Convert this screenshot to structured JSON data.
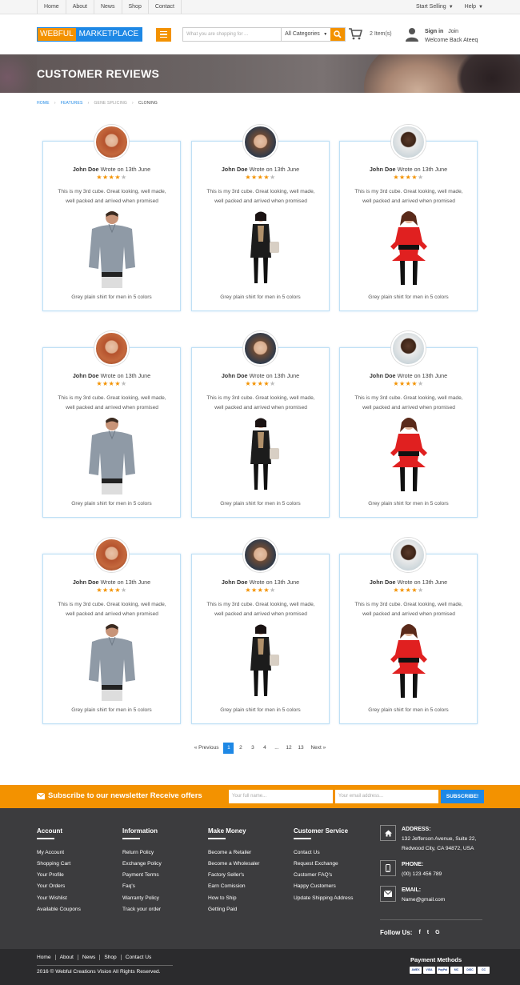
{
  "topbar": {
    "nav": [
      "Home",
      "About",
      "News",
      "Shop",
      "Contact"
    ],
    "start_selling": "Start Selling",
    "help": "Help"
  },
  "header": {
    "logo_part1": "WEBFUL",
    "logo_part2": "MARKETPLACE",
    "search_placeholder": "What you are shopping for ...",
    "category": "All Categories",
    "cart_count": "2 Item(s)",
    "sign_in": "Sign in",
    "join": "Join",
    "welcome": "Welcome Back Ateeq"
  },
  "banner": {
    "title": "CUSTOMER REVIEWS"
  },
  "breadcrumb": [
    "HOME",
    "FEATURES",
    "GENE SPLICING",
    "CLONING"
  ],
  "reviews": [
    {
      "name": "John Doe",
      "wrote": "Wrote on 13th June",
      "rating": 4,
      "text": "This is my 3rd cube. Great looking, well made, well packed and arrived when promised",
      "caption": "Grey plain shirt for men in 5 colors",
      "avatar": "woman-redhead",
      "product": "grey-shirt"
    },
    {
      "name": "John Doe",
      "wrote": "Wrote on 13th June",
      "rating": 4,
      "text": "This is my 3rd cube. Great looking, well made, well packed and arrived when promised",
      "caption": "Grey plain shirt for men in 5 colors",
      "avatar": "man-glasses",
      "product": "black-coat"
    },
    {
      "name": "John Doe",
      "wrote": "Wrote on 13th June",
      "rating": 4,
      "text": "This is my 3rd cube. Great looking, well made, well packed and arrived when promised",
      "caption": "Grey plain shirt for men in 5 colors",
      "avatar": "man-smiling",
      "product": "red-top"
    },
    {
      "name": "John Doe",
      "wrote": "Wrote on 13th June",
      "rating": 4,
      "text": "This is my 3rd cube. Great looking, well made, well packed and arrived when promised",
      "caption": "Grey plain shirt for men in 5 colors",
      "avatar": "woman-redhead",
      "product": "grey-shirt"
    },
    {
      "name": "John Doe",
      "wrote": "Wrote on 13th June",
      "rating": 4,
      "text": "This is my 3rd cube. Great looking, well made, well packed and arrived when promised",
      "caption": "Grey plain shirt for men in 5 colors",
      "avatar": "man-glasses",
      "product": "black-coat"
    },
    {
      "name": "John Doe",
      "wrote": "Wrote on 13th June",
      "rating": 4,
      "text": "This is my 3rd cube. Great looking, well made, well packed and arrived when promised",
      "caption": "Grey plain shirt for men in 5 colors",
      "avatar": "man-smiling",
      "product": "red-top"
    },
    {
      "name": "John Doe",
      "wrote": "Wrote on 13th June",
      "rating": 4,
      "text": "This is my 3rd cube. Great looking, well made, well packed and arrived when promised",
      "caption": "Grey plain shirt for men in 5 colors",
      "avatar": "woman-redhead",
      "product": "grey-shirt"
    },
    {
      "name": "John Doe",
      "wrote": "Wrote on 13th June",
      "rating": 4,
      "text": "This is my 3rd cube. Great looking, well made, well packed and arrived when promised",
      "caption": "Grey plain shirt for men in 5 colors",
      "avatar": "man-glasses",
      "product": "black-coat"
    },
    {
      "name": "John Doe",
      "wrote": "Wrote on 13th June",
      "rating": 4,
      "text": "This is my 3rd cube. Great looking, well made, well packed and arrived when promised",
      "caption": "Grey plain shirt for men in 5 colors",
      "avatar": "man-smiling",
      "product": "red-top"
    }
  ],
  "pagination": {
    "previous": "« Previous",
    "pages": [
      "1",
      "2",
      "3",
      "4",
      "...",
      "12",
      "13"
    ],
    "current": "1",
    "next": "Next »"
  },
  "newsletter": {
    "title": "Subscribe to our newsletter Receive offers",
    "name_placeholder": "Your full name...",
    "email_placeholder": "Your email address...",
    "button": "SUBSCRIBE!"
  },
  "footer": {
    "account": {
      "title": "Account",
      "links": [
        "My Account",
        "Shopping Cart",
        "Your Profile",
        "Your Orders",
        "Your Wishlist",
        "Available Coupons"
      ]
    },
    "information": {
      "title": "Information",
      "links": [
        "Return Policy",
        "Exchange Policy",
        "Payment Terms",
        "Faq's",
        "Warranty Policy",
        "Track your order"
      ]
    },
    "make_money": {
      "title": "Make Money",
      "links": [
        "Become a Retailer",
        "Become a Wholesaler",
        "Factory Seller's",
        "Earn Comission",
        "How to Ship",
        "Getting Paid"
      ]
    },
    "customer_service": {
      "title": "Customer Service",
      "links": [
        "Contact Us",
        "Request Exchange",
        "Customer FAQ's",
        "Happy Customers",
        "Update Shipping Address"
      ]
    },
    "address_label": "ADDRESS:",
    "address": "132 Jefferson Avenue, Suite 22, Redwood City, CA 94872, USA",
    "phone_label": "PHONE:",
    "phone": "(00) 123 456 789",
    "email_label": "EMAIL:",
    "email": "Name@gmail.com",
    "follow": "Follow Us:",
    "social": [
      "f",
      "t",
      "G"
    ]
  },
  "bottom": {
    "nav": [
      "Home",
      "About",
      "News",
      "Shop",
      "Contact Us"
    ],
    "copyright": "2016 © Webful Creations Vision All Rights Reserved.",
    "payment_title": "Payment Methods",
    "payment_logos": [
      "AMEX",
      "VISA",
      "PayPal",
      "MC",
      "DISC",
      "CC"
    ]
  },
  "colors": {
    "accent": "#f39200",
    "brand": "#1e88e5",
    "footer": "#3c3c3e",
    "bottom": "#2b2b2d"
  }
}
